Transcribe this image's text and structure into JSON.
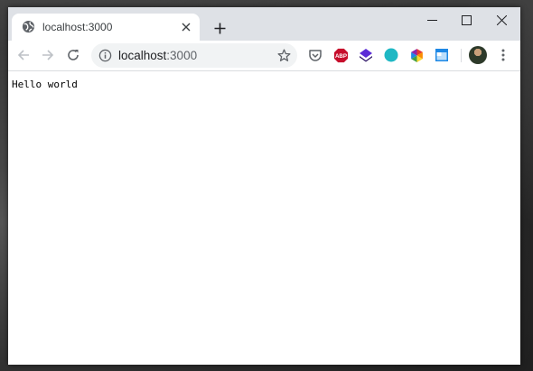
{
  "tab": {
    "title": "localhost:3000",
    "favicon": "globe-icon",
    "close": "close-icon"
  },
  "new_tab": "plus-icon",
  "window_controls": [
    "minimize-icon",
    "maximize-icon",
    "close-icon"
  ],
  "toolbar": {
    "back": "arrow-left-icon",
    "forward": "arrow-right-icon",
    "reload": "reload-icon",
    "url_host": "localhost",
    "url_port": ":3000",
    "info_icon": "info-icon",
    "star_icon": "star-icon",
    "extensions": [
      "pocket-icon",
      "adblock-icon",
      "layers-icon",
      "teal-circle-icon",
      "color-wheel-icon",
      "window-icon"
    ],
    "abp_label": "ABP",
    "menu": "more-vert-icon"
  },
  "page": {
    "text": "Hello world"
  },
  "colors": {
    "tabstrip": "#dee1e6",
    "omnibox": "#f1f3f4",
    "abp_red": "#c70d2c",
    "teal": "#1fb8c4",
    "layers_purple": "#3d1a8c"
  }
}
